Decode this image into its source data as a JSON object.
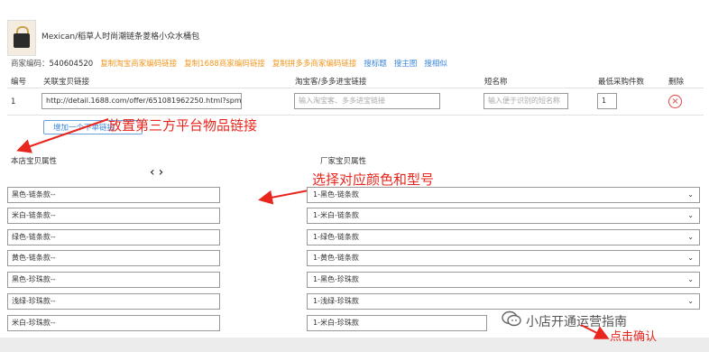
{
  "product": {
    "image_icon": "handbag-image",
    "title": "Mexican/稻草人时尚潮链条菱格小众水桶包"
  },
  "info": {
    "merchant_code_label": "商家编码：",
    "merchant_code": "540604520",
    "links": [
      {
        "label": "复制淘宝商家编码链接",
        "color": "#f0961e"
      },
      {
        "label": "复制1688商家编码链接",
        "color": "#f0961e"
      },
      {
        "label": "复制拼多多商家编码链接",
        "color": "#f0961e"
      },
      {
        "label": "搜标题",
        "color": "#3a86d8"
      },
      {
        "label": "搜主图",
        "color": "#3a86d8"
      },
      {
        "label": "搜相似",
        "color": "#3a86d8"
      }
    ]
  },
  "table": {
    "headers": [
      "编号",
      "关联宝贝链接",
      "淘宝客/多多进宝链接",
      "短名称",
      "最低采购件数",
      "删除"
    ],
    "row": {
      "index": "1",
      "link_value": "http://detail.1688.com/offer/651081962250.html?spm=",
      "tk_placeholder": "输入淘宝客、多多进宝链接",
      "short_name_placeholder": "输入便于识别的短名称",
      "min_qty": "1",
      "delete_icon": "close-circle-icon"
    },
    "add_button": "增加一个下单链接"
  },
  "annotations": {
    "link_tip": "放置第三方平台物品链接",
    "select_tip": "选择对应颜色和型号",
    "confirm_tip": "点击确认"
  },
  "attributes": {
    "left_label": "本店宝贝属性",
    "right_label": "厂家宝贝属性",
    "nav_prev": "‹",
    "nav_next": "›",
    "rows": [
      {
        "left": "黑色-链条款--",
        "right": "1-黑色-链条款"
      },
      {
        "left": "米白-链条款--",
        "right": "1-米白-链条款"
      },
      {
        "left": "绿色-链条款--",
        "right": "1-绿色-链条款"
      },
      {
        "left": "黄色-链条款--",
        "right": "1-黄色-链条款"
      },
      {
        "left": "黑色-珍珠款--",
        "right": "1-黑色-珍珠款"
      },
      {
        "left": "浅绿-珍珠款--",
        "right": "1-浅绿-珍珠款"
      },
      {
        "left": "米白-珍珠款--",
        "right": "1-米白-珍珠款"
      }
    ]
  },
  "watermark": {
    "icon": "wechat-official-account-icon",
    "text": "小店开通运营指南"
  },
  "colors": {
    "accent_red": "#e8261e",
    "link_orange": "#f0961e",
    "link_blue": "#3a86d8"
  }
}
